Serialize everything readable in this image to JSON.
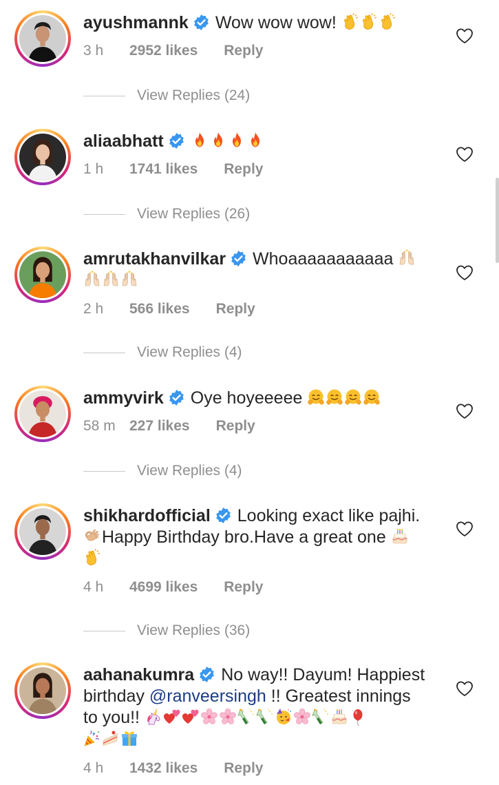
{
  "comments": [
    {
      "username": "ayushmannk",
      "verified": true,
      "line1": "Wow wow wow!",
      "line1_emojis": [
        "clap",
        "clap",
        "clap"
      ],
      "time": "3 h",
      "likes": "2952 likes",
      "reply": "Reply",
      "view_replies": "View Replies (24)",
      "avatar_icon": "man-portrait"
    },
    {
      "username": "aliaabhatt",
      "verified": true,
      "line1": "",
      "line1_emojis": [
        "fire",
        "fire",
        "fire",
        "fire"
      ],
      "time": "1 h",
      "likes": "1741 likes",
      "reply": "Reply",
      "view_replies": "View Replies (26)",
      "avatar_icon": "woman-portrait"
    },
    {
      "username": "amrutakhanvilkar",
      "verified": true,
      "line1": "Whoaaaaaaaaaaa",
      "line1_emojis": [
        "raised-hands"
      ],
      "line2_emojis": [
        "raised-hands",
        "raised-hands",
        "raised-hands"
      ],
      "time": "2 h",
      "likes": "566 likes",
      "reply": "Reply",
      "view_replies": "View Replies (4)",
      "avatar_icon": "woman-outdoor-portrait"
    },
    {
      "username": "ammyvirk",
      "verified": true,
      "line1": "Oye hoyeeeee",
      "line1_emojis": [
        "hugging",
        "hugging",
        "hugging",
        "hugging"
      ],
      "time": "58 m",
      "likes": "227 likes",
      "reply": "Reply",
      "view_replies": "View Replies (4)",
      "avatar_icon": "man-turban-portrait"
    },
    {
      "username": "shikhardofficial",
      "verified": true,
      "line1": "Looking exact like pajhi.",
      "line2": "Happy Birthday bro.Have a great one",
      "line2_lead_emoji": "ok-hand",
      "line2_emoji": "birthday-cake",
      "line3_emojis": [
        "clap"
      ],
      "time": "4 h",
      "likes": "4699 likes",
      "reply": "Reply",
      "view_replies": "View Replies (36)",
      "avatar_icon": "man-portrait"
    },
    {
      "username": "aahanakumra",
      "verified": true,
      "line1": "No way!! Dayum! Happiest",
      "line2_pre": "birthday ",
      "line2_mention": "@ranveersingh",
      "line2_post": " !! Greatest innings",
      "line3": "to you!!",
      "line3_emojis": [
        "unicorn",
        "two-hearts",
        "two-hearts",
        "cherry-blossom",
        "cherry-blossom",
        "champagne",
        "champagne",
        "party-face",
        "cherry-blossom",
        "champagne",
        "birthday-cake",
        "balloon"
      ],
      "line4_emojis": [
        "party-popper",
        "shortcake",
        "gift"
      ],
      "time": "4 h",
      "likes": "1432 likes",
      "reply": "Reply",
      "avatar_icon": "woman-portrait"
    }
  ],
  "colors": {
    "text": "#262626",
    "meta": "#8e8e8e",
    "verified": "#3897f0",
    "mention": "#1b3d85"
  },
  "icons": {
    "like": "heart-outline-icon",
    "verified": "verified-badge-icon"
  }
}
